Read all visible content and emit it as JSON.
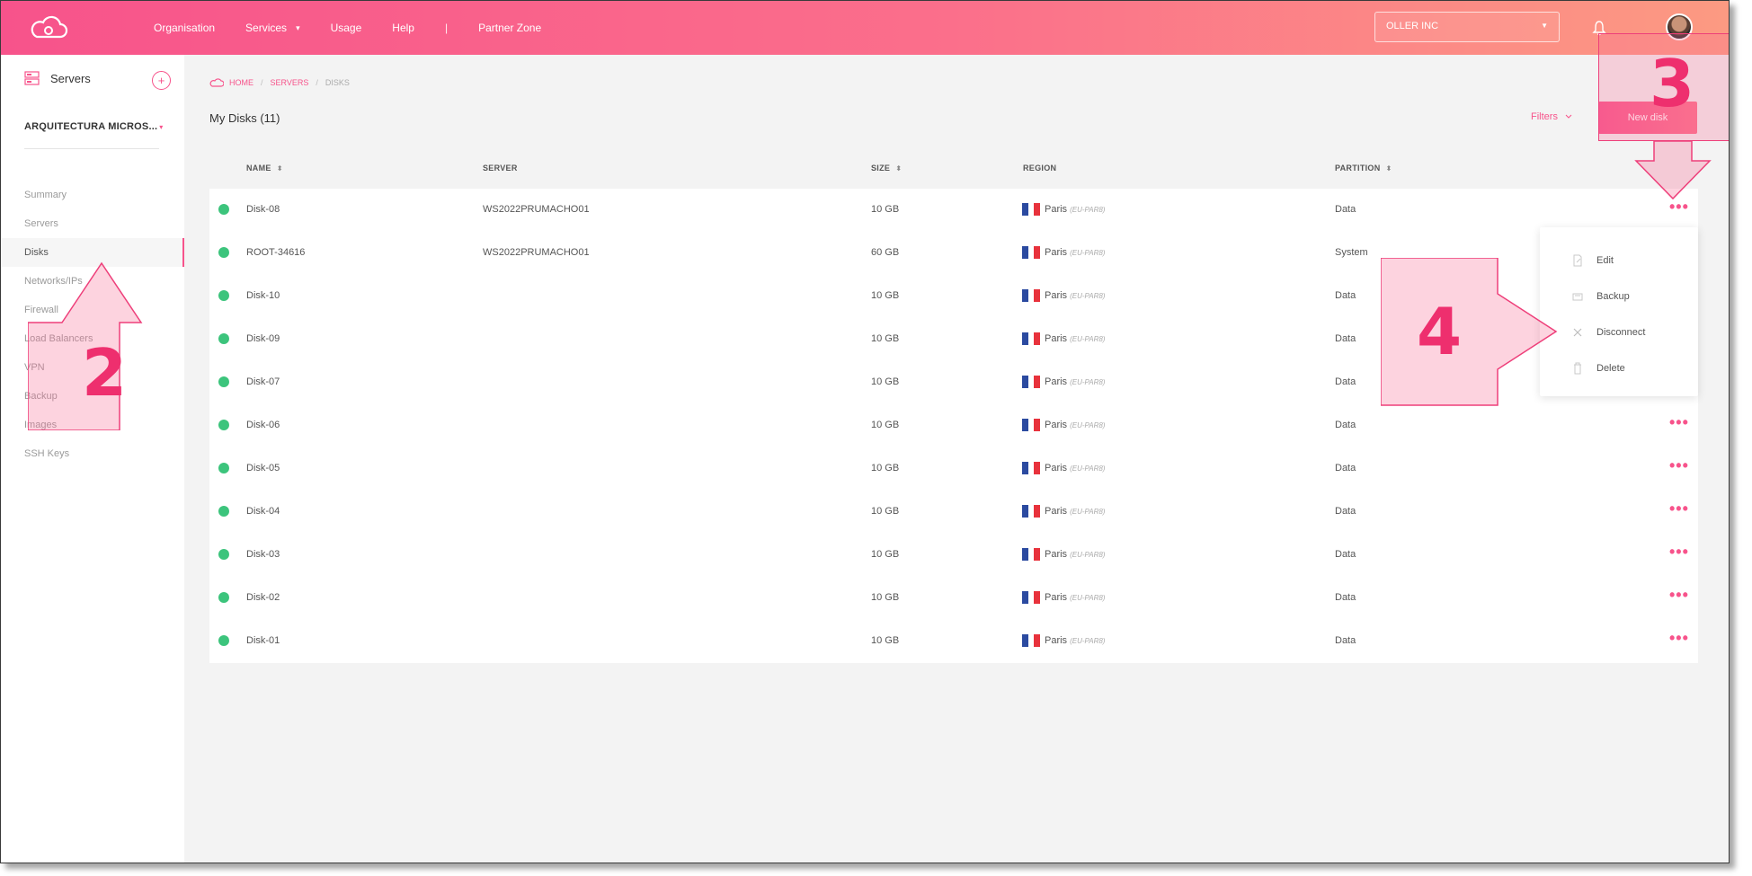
{
  "topbar": {
    "nav": [
      "Organisation",
      "Services",
      "Usage",
      "Help",
      "Partner Zone"
    ],
    "services_caret": "▾",
    "separator": "|",
    "org": "OLLER INC",
    "org_caret": "▼"
  },
  "sidebar": {
    "title": "Servers",
    "add": "+",
    "project": "ARQUITECTURA MICROS...",
    "project_caret": "▾",
    "items": [
      "Summary",
      "Servers",
      "Disks",
      "Networks/IPs",
      "Firewall",
      "Load Balancers",
      "VPN",
      "Backup",
      "Images",
      "SSH Keys"
    ],
    "active": "Disks"
  },
  "breadcrumb": {
    "home": "HOME",
    "servers": "SERVERS",
    "current": "DISKS",
    "sep": "/"
  },
  "page": {
    "title": "My Disks (11)",
    "filters": "Filters",
    "new_disk": "New disk"
  },
  "columns": {
    "name": "NAME",
    "server": "SERVER",
    "size": "SIZE",
    "region": "REGION",
    "partition": "PARTITION",
    "sort": "⬍"
  },
  "disks": [
    {
      "name": "Disk-08",
      "server": "WS2022PRUMACHO01",
      "size": "10 GB",
      "city": "Paris",
      "region": "(EU-PAR8)",
      "partition": "Data"
    },
    {
      "name": "ROOT-34616",
      "server": "WS2022PRUMACHO01",
      "size": "60 GB",
      "city": "Paris",
      "region": "(EU-PAR8)",
      "partition": "System"
    },
    {
      "name": "Disk-10",
      "server": "",
      "size": "10 GB",
      "city": "Paris",
      "region": "(EU-PAR8)",
      "partition": "Data"
    },
    {
      "name": "Disk-09",
      "server": "",
      "size": "10 GB",
      "city": "Paris",
      "region": "(EU-PAR8)",
      "partition": "Data"
    },
    {
      "name": "Disk-07",
      "server": "",
      "size": "10 GB",
      "city": "Paris",
      "region": "(EU-PAR8)",
      "partition": "Data"
    },
    {
      "name": "Disk-06",
      "server": "",
      "size": "10 GB",
      "city": "Paris",
      "region": "(EU-PAR8)",
      "partition": "Data"
    },
    {
      "name": "Disk-05",
      "server": "",
      "size": "10 GB",
      "city": "Paris",
      "region": "(EU-PAR8)",
      "partition": "Data"
    },
    {
      "name": "Disk-04",
      "server": "",
      "size": "10 GB",
      "city": "Paris",
      "region": "(EU-PAR8)",
      "partition": "Data"
    },
    {
      "name": "Disk-03",
      "server": "",
      "size": "10 GB",
      "city": "Paris",
      "region": "(EU-PAR8)",
      "partition": "Data"
    },
    {
      "name": "Disk-02",
      "server": "",
      "size": "10 GB",
      "city": "Paris",
      "region": "(EU-PAR8)",
      "partition": "Data"
    },
    {
      "name": "Disk-01",
      "server": "",
      "size": "10 GB",
      "city": "Paris",
      "region": "(EU-PAR8)",
      "partition": "Data"
    }
  ],
  "row_actions": "•••",
  "context_menu": [
    "Edit",
    "Backup",
    "Disconnect",
    "Delete"
  ],
  "annotations": [
    "2",
    "3",
    "4"
  ],
  "colors": {
    "accent": "#f7538b",
    "online": "#3cc47c",
    "flag_blue": "#2b4aa0",
    "flag_red": "#e8323c"
  }
}
